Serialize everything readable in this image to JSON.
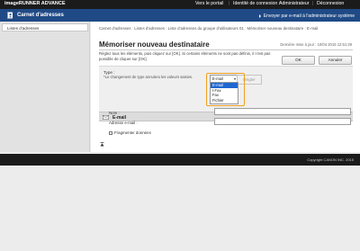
{
  "header": {
    "brand": "imageRUNNER ADVANCE",
    "nav": [
      "Vers le portail",
      "Identité de connexion :",
      "Administrateur",
      "Déconnexion"
    ]
  },
  "subheader": {
    "title": "Carnet d'adresses",
    "email_admin_link": "Envoyer par e-mail à l'administrateur système"
  },
  "sidebar": {
    "items": [
      "Listes d'adresses"
    ]
  },
  "breadcrumb": {
    "items": [
      "Carnet d'adresses",
      "Listes d'adresses",
      "Liste d'adresses du groupe d'utilisateurs 01",
      "Mémoriser nouveau destinataire : E-mail"
    ]
  },
  "page": {
    "title": "Mémoriser nouveau destinataire",
    "last_updated": "Dernière mise à jour : 10/04 2015 12:51:29",
    "instructions": "Réglez tous les éléments, puis cliquez sur [OK]. Si certains éléments ne sont pas définis, il n'est pas possible de cliquer sur [OK].",
    "ok_button": "OK",
    "cancel_button": "Annuler"
  },
  "type_section": {
    "label": "Type :",
    "note": "*Le changement de type annulera les valeurs saisies.",
    "selected": "E-mail",
    "options": [
      "E-mail",
      "I-Fax",
      "Fax",
      "Fichier"
    ],
    "apply_button": "Régler"
  },
  "email_section": {
    "title": "E-mail",
    "name_label": "Nom :",
    "address_label": "Adresse e-mail :",
    "name_value": "",
    "address_value": "",
    "fragment_label": "Fragmenter données"
  },
  "footer": {
    "copyright": "Copyright CANON INC. 2015"
  },
  "colors": {
    "accent": "#1f4a86",
    "highlight": "#f0a020",
    "selection": "#1f66d1"
  }
}
